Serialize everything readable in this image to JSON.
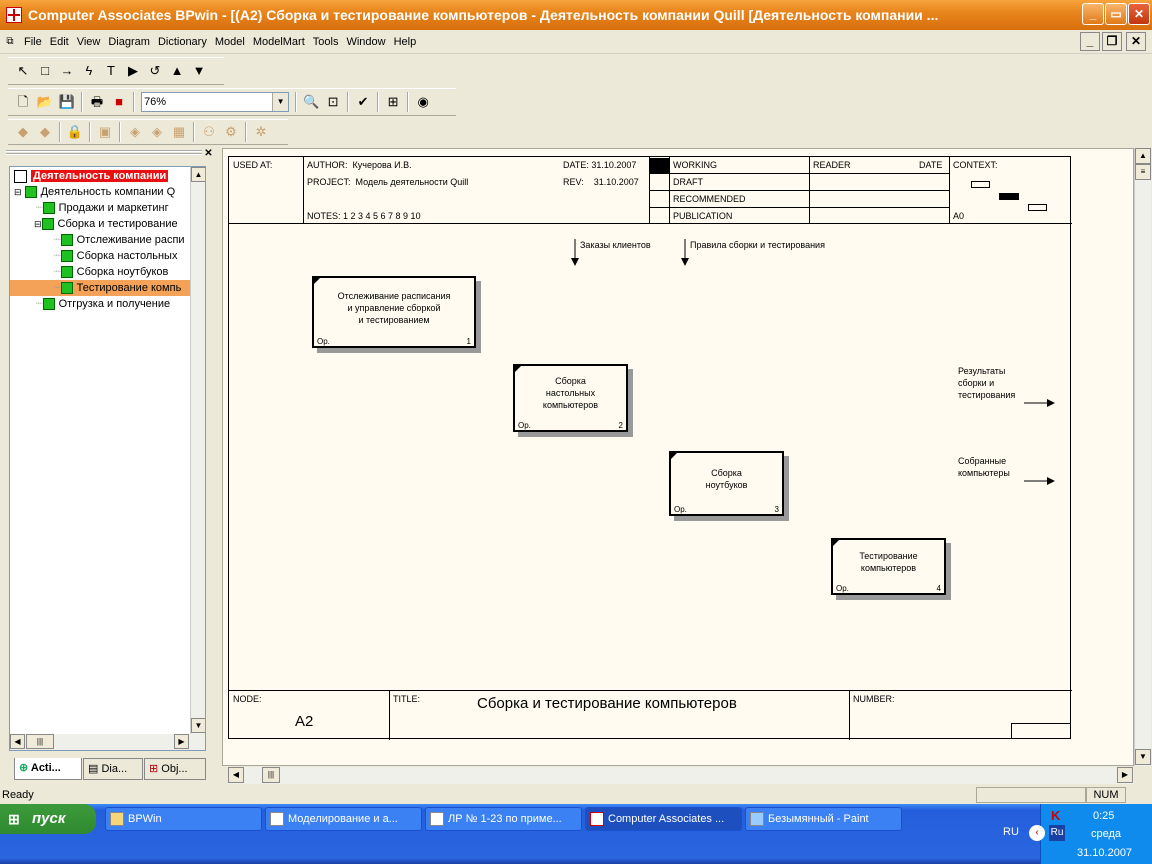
{
  "window": {
    "title": "Computer Associates BPwin - [(A2) Сборка и тестирование компьютеров - Деятельность компании Quill  [Деятельность компании ..."
  },
  "menu": [
    "File",
    "Edit",
    "View",
    "Diagram",
    "Dictionary",
    "Model",
    "ModelMart",
    "Tools",
    "Window",
    "Help"
  ],
  "toolbar": {
    "zoom": "76%"
  },
  "tree": {
    "root": "Деятельность компании",
    "items": [
      "Деятельность компании Q",
      "Продажи и маркетинг",
      "Сборка и тестирование",
      "Отслеживание распи",
      "Сборка настольных",
      "Сборка ноутбуков",
      "Тестирование компь",
      "Отгрузка и получение"
    ]
  },
  "tabs": [
    "Acti...",
    "Dia...",
    "Obj..."
  ],
  "header": {
    "used_at": "USED AT:",
    "author_label": "AUTHOR:",
    "author": "Кучерова И.В.",
    "project_label": "PROJECT:",
    "project": "Модель деятельности Quill",
    "date_label": "DATE:",
    "date": "31.10.2007",
    "rev_label": "REV:",
    "rev": "31.10.2007",
    "notes": "NOTES:  1  2  3  4  5  6  7  8  9  10",
    "working": "WORKING",
    "draft": "DRAFT",
    "recommended": "RECOMMENDED",
    "publication": "PUBLICATION",
    "reader": "READER",
    "date2": "DATE",
    "context": "CONTEXT:",
    "a0": "A0"
  },
  "diagram": {
    "arrows_top": [
      "Заказы клиентов",
      "Правила сборки и тестирования"
    ],
    "outputs": [
      "Результаты\nсборки и\nтестирования",
      "Собранные\nкомпьютеры"
    ],
    "boxes": [
      {
        "text": "Отслеживание расписания\nи управление сборкой\nи тестированием",
        "op": "Op.",
        "num": "1"
      },
      {
        "text": "Сборка\nнастольных\nкомпьютеров",
        "op": "Op.",
        "num": "2"
      },
      {
        "text": "Сборка\nноутбуков",
        "op": "Op.",
        "num": "3"
      },
      {
        "text": "Тестирование\nкомпьютеров",
        "op": "Op.",
        "num": "4"
      }
    ]
  },
  "footer": {
    "node_label": "NODE:",
    "node": "A2",
    "title_label": "TITLE:",
    "title": "Сборка и тестирование компьютеров",
    "number_label": "NUMBER:"
  },
  "status": {
    "left": "Ready",
    "num": "NUM"
  },
  "taskbar": {
    "start": "пуск",
    "tasks": [
      "BPWin",
      "Моделирование и а...",
      "ЛР № 1-23 по приме...",
      "Computer Associates ...",
      "Безымянный - Paint"
    ],
    "lang": "RU",
    "time": "0:25",
    "day": "среда",
    "date": "31.10.2007"
  }
}
